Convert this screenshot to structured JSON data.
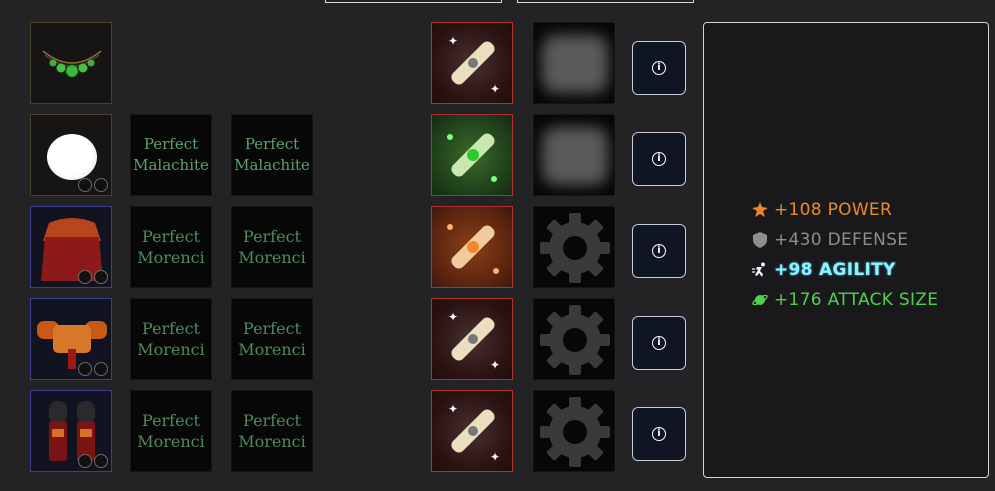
{
  "equipment": [
    {
      "name": "necklace",
      "sockets": 0
    },
    {
      "name": "orb",
      "sockets": 2
    },
    {
      "name": "cape",
      "sockets": 2
    },
    {
      "name": "chest-armor",
      "sockets": 2
    },
    {
      "name": "boots",
      "sockets": 2
    }
  ],
  "gems": [
    [
      "",
      ""
    ],
    [
      "Perfect Malachite",
      "Perfect Malachite"
    ],
    [
      "Perfect Morenci",
      "Perfect Morenci"
    ],
    [
      "Perfect Morenci",
      "Perfect Morenci"
    ],
    [
      "Perfect Morenci",
      "Perfect Morenci"
    ]
  ],
  "scrolls": [
    "red",
    "green",
    "orange",
    "red",
    "red"
  ],
  "runes": [
    "blurred",
    "blurred",
    "gear",
    "gear",
    "gear"
  ],
  "info_button_icon": "info-icon",
  "stats": {
    "power": "+108 POWER",
    "defense": "+430 DEFENSE",
    "agility": "+98 AGILITY",
    "attack_size": "+176 ATTACK SIZE"
  },
  "colors": {
    "power": "#ec8a2a",
    "defense": "#8e8e8e",
    "agility": "#8ff2ff",
    "attack_size": "#4ed24e"
  }
}
